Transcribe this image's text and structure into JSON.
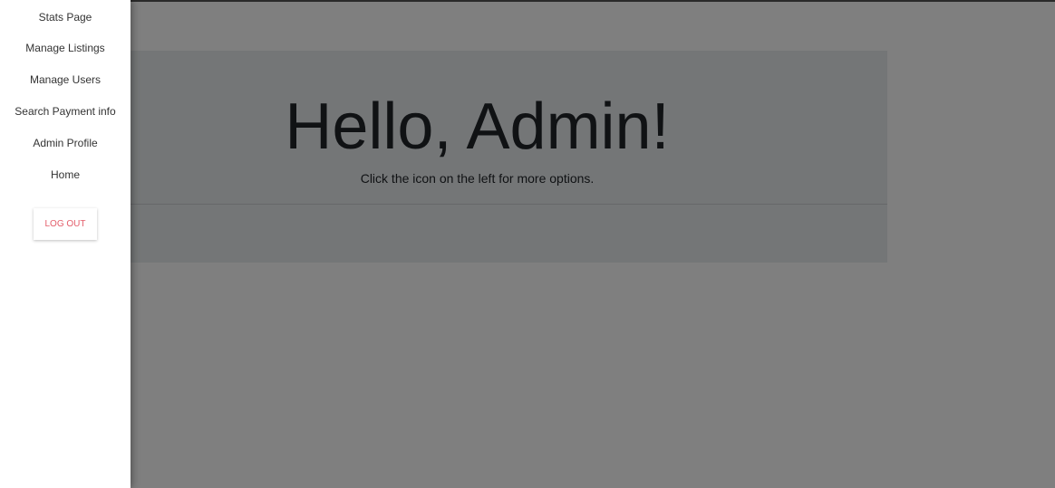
{
  "main": {
    "title": "Hello, Admin!",
    "subtitle": "Click the icon on the left for more options."
  },
  "sidebar": {
    "items": [
      {
        "label": "Stats Page"
      },
      {
        "label": "Manage Listings"
      },
      {
        "label": "Manage Users"
      },
      {
        "label": "Search Payment info"
      },
      {
        "label": "Admin Profile"
      },
      {
        "label": "Home"
      }
    ],
    "logout_label": "LOG OUT"
  },
  "colors": {
    "overlay": "#000000",
    "logout_text": "#e35d6a",
    "jumbotron_bg": "#e9ecef"
  }
}
